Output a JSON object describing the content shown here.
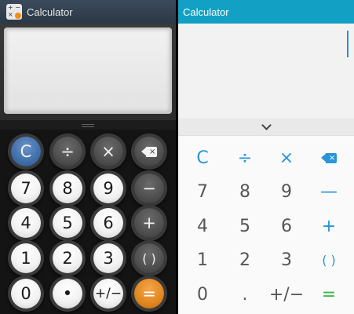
{
  "left_app": {
    "title": "Calculator",
    "icon_glyphs": [
      "+",
      "−",
      "×",
      ""
    ],
    "display_value": "",
    "keys": [
      {
        "id": "clear",
        "label": "C",
        "style": "clear",
        "icon": ""
      },
      {
        "id": "divide",
        "label": "÷",
        "style": "op",
        "icon": ""
      },
      {
        "id": "multiply",
        "label": "×",
        "style": "op",
        "icon": ""
      },
      {
        "id": "backspace",
        "label": "",
        "style": "op",
        "icon": "backspace-icon"
      },
      {
        "id": "7",
        "label": "7",
        "style": "digit",
        "icon": ""
      },
      {
        "id": "8",
        "label": "8",
        "style": "digit",
        "icon": ""
      },
      {
        "id": "9",
        "label": "9",
        "style": "digit",
        "icon": ""
      },
      {
        "id": "minus",
        "label": "−",
        "style": "op",
        "icon": ""
      },
      {
        "id": "4",
        "label": "4",
        "style": "digit",
        "icon": ""
      },
      {
        "id": "5",
        "label": "5",
        "style": "digit",
        "icon": ""
      },
      {
        "id": "6",
        "label": "6",
        "style": "digit",
        "icon": ""
      },
      {
        "id": "plus",
        "label": "+",
        "style": "op",
        "icon": ""
      },
      {
        "id": "1",
        "label": "1",
        "style": "digit",
        "icon": ""
      },
      {
        "id": "2",
        "label": "2",
        "style": "digit",
        "icon": ""
      },
      {
        "id": "3",
        "label": "3",
        "style": "digit",
        "icon": ""
      },
      {
        "id": "parentheses",
        "label": "( )",
        "style": "op",
        "icon": ""
      },
      {
        "id": "0",
        "label": "0",
        "style": "digit",
        "icon": ""
      },
      {
        "id": "decimal",
        "label": "•",
        "style": "digit",
        "icon": ""
      },
      {
        "id": "plusminus",
        "label": "+/−",
        "style": "digit",
        "icon": ""
      },
      {
        "id": "equals",
        "label": "=",
        "style": "eq",
        "icon": ""
      }
    ]
  },
  "right_app": {
    "title": "Calculator",
    "display_value": "",
    "toggle_icon": "chevron-down-icon",
    "keys": [
      {
        "id": "clear",
        "label": "C",
        "color": "blue",
        "icon": ""
      },
      {
        "id": "divide",
        "label": "÷",
        "color": "blue",
        "icon": ""
      },
      {
        "id": "multiply",
        "label": "×",
        "color": "blue",
        "icon": ""
      },
      {
        "id": "backspace",
        "label": "",
        "color": "blue",
        "icon": "backspace-icon"
      },
      {
        "id": "7",
        "label": "7",
        "color": "gray",
        "icon": ""
      },
      {
        "id": "8",
        "label": "8",
        "color": "gray",
        "icon": ""
      },
      {
        "id": "9",
        "label": "9",
        "color": "gray",
        "icon": ""
      },
      {
        "id": "minus",
        "label": "—",
        "color": "blue",
        "icon": ""
      },
      {
        "id": "4",
        "label": "4",
        "color": "gray",
        "icon": ""
      },
      {
        "id": "5",
        "label": "5",
        "color": "gray",
        "icon": ""
      },
      {
        "id": "6",
        "label": "6",
        "color": "gray",
        "icon": ""
      },
      {
        "id": "plus",
        "label": "+",
        "color": "blue",
        "icon": ""
      },
      {
        "id": "1",
        "label": "1",
        "color": "gray",
        "icon": ""
      },
      {
        "id": "2",
        "label": "2",
        "color": "gray",
        "icon": ""
      },
      {
        "id": "3",
        "label": "3",
        "color": "gray",
        "icon": ""
      },
      {
        "id": "parentheses",
        "label": "( )",
        "color": "blue",
        "icon": ""
      },
      {
        "id": "0",
        "label": "0",
        "color": "gray",
        "icon": ""
      },
      {
        "id": "decimal",
        "label": ".",
        "color": "gray",
        "icon": ""
      },
      {
        "id": "plusminus",
        "label": "+/−",
        "color": "gray",
        "icon": ""
      },
      {
        "id": "equals",
        "label": "=",
        "color": "green",
        "icon": ""
      }
    ]
  },
  "colors": {
    "left_titlebar": "#2b3846",
    "left_clear_key": "#3f6ea9",
    "left_equals_key": "#e0861f",
    "right_titlebar": "#12a0c4",
    "right_accent_blue": "#2a95d6",
    "right_equals_green": "#3cb84a",
    "right_cursor": "#2a8fd6"
  }
}
